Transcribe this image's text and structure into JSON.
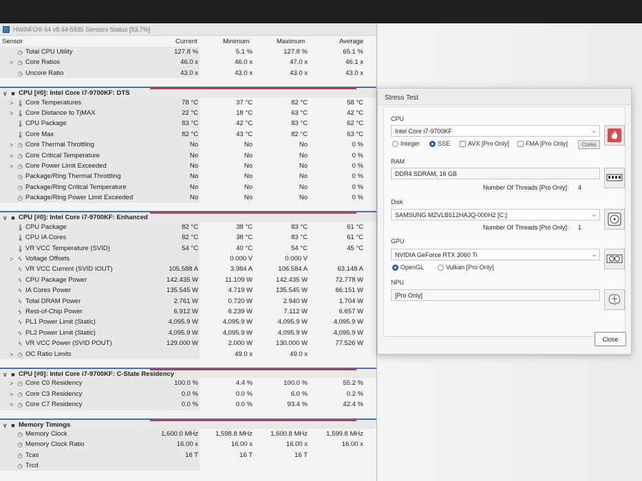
{
  "window_title": "HWiNFO® 64 v8.44-5935 Sensors Status [93.7%]",
  "columns": {
    "sensor": "Sensor",
    "current": "Current",
    "minimum": "Minimum",
    "maximum": "Maximum",
    "average": "Average"
  },
  "top_rows": [
    {
      "name": "Total CPU Utility",
      "icon": "clock-icon",
      "current": "127.8 %",
      "min": "5.1 %",
      "max": "127.8 %",
      "avg": "65.1 %"
    },
    {
      "name": "Core Ratios",
      "icon": "clock-icon",
      "expand": ">",
      "current": "46.0 x",
      "min": "46.0 x",
      "max": "47.0 x",
      "avg": "46.1 x"
    },
    {
      "name": "Uncore Ratio",
      "icon": "clock-icon",
      "current": "43.0 x",
      "min": "43.0 x",
      "max": "43.0 x",
      "avg": "43.0 x"
    }
  ],
  "sections": [
    {
      "title": "CPU [#0]: Intel Core i7-9700KF: DTS",
      "rows": [
        {
          "name": "Core Temperatures",
          "icon": "thermometer-icon",
          "expand": ">",
          "current": "78 °C",
          "min": "37 °C",
          "max": "82 °C",
          "avg": "58 °C"
        },
        {
          "name": "Core Distance to TjMAX",
          "icon": "thermometer-icon",
          "expand": ">",
          "current": "22 °C",
          "min": "18 °C",
          "max": "63 °C",
          "avg": "42 °C"
        },
        {
          "name": "CPU Package",
          "icon": "thermometer-icon",
          "current": "83 °C",
          "min": "42 °C",
          "max": "83 °C",
          "avg": "62 °C"
        },
        {
          "name": "Core Max",
          "icon": "thermometer-icon",
          "current": "82 °C",
          "min": "43 °C",
          "max": "82 °C",
          "avg": "63 °C"
        },
        {
          "name": "Core Thermal Throttling",
          "icon": "clock-icon",
          "expand": ">",
          "current": "No",
          "min": "No",
          "max": "No",
          "avg": "0 %"
        },
        {
          "name": "Core Critical Temperature",
          "icon": "clock-icon",
          "expand": ">",
          "current": "No",
          "min": "No",
          "max": "No",
          "avg": "0 %"
        },
        {
          "name": "Core Power Limit Exceeded",
          "icon": "clock-icon",
          "expand": ">",
          "current": "No",
          "min": "No",
          "max": "No",
          "avg": "0 %"
        },
        {
          "name": "Package/Ring Thermal Throttling",
          "icon": "clock-icon",
          "current": "No",
          "min": "No",
          "max": "No",
          "avg": "0 %"
        },
        {
          "name": "Package/Ring Critical Temperature",
          "icon": "clock-icon",
          "current": "No",
          "min": "No",
          "max": "No",
          "avg": "0 %"
        },
        {
          "name": "Package/Ring Power Limit Exceeded",
          "icon": "clock-icon",
          "current": "No",
          "min": "No",
          "max": "No",
          "avg": "0 %"
        }
      ]
    },
    {
      "title": "CPU [#0]: Intel Core i7-9700KF: Enhanced",
      "rows": [
        {
          "name": "CPU Package",
          "icon": "thermometer-icon",
          "current": "82 °C",
          "min": "38 °C",
          "max": "83 °C",
          "avg": "61 °C"
        },
        {
          "name": "CPU IA Cores",
          "icon": "thermometer-icon",
          "current": "82 °C",
          "min": "38 °C",
          "max": "83 °C",
          "avg": "61 °C"
        },
        {
          "name": "VR VCC Temperature (SVID)",
          "icon": "thermometer-icon",
          "current": "54 °C",
          "min": "40 °C",
          "max": "54 °C",
          "avg": "45 °C"
        },
        {
          "name": "Voltage Offsets",
          "icon": "lightning-icon",
          "expand": ">",
          "current": "",
          "min": "0.000 V",
          "max": "0.000 V",
          "avg": ""
        },
        {
          "name": "VR VCC Current (SVID IOUT)",
          "icon": "lightning-icon",
          "current": "105.588 A",
          "min": "3.984 A",
          "max": "106.584 A",
          "avg": "63.148 A"
        },
        {
          "name": "CPU Package Power",
          "icon": "lightning-icon",
          "current": "142.435 W",
          "min": "11.109 W",
          "max": "142.435 W",
          "avg": "72.778 W"
        },
        {
          "name": "IA Cores Power",
          "icon": "lightning-icon",
          "current": "135.545 W",
          "min": "4.719 W",
          "max": "135.545 W",
          "avg": "66.151 W"
        },
        {
          "name": "Total DRAM Power",
          "icon": "lightning-icon",
          "current": "2.761 W",
          "min": "0.720 W",
          "max": "2.940 W",
          "avg": "1.704 W"
        },
        {
          "name": "Rest-of-Chip Power",
          "icon": "lightning-icon",
          "current": "6.912 W",
          "min": "6.239 W",
          "max": "7.112 W",
          "avg": "6.657 W"
        },
        {
          "name": "PL1 Power Limit (Static)",
          "icon": "lightning-icon",
          "current": "4,095.9 W",
          "min": "4,095.9 W",
          "max": "4,095.9 W",
          "avg": "4,095.9 W"
        },
        {
          "name": "PL2 Power Limit (Static)",
          "icon": "lightning-icon",
          "current": "4,095.9 W",
          "min": "4,095.9 W",
          "max": "4,095.9 W",
          "avg": "4,095.9 W"
        },
        {
          "name": "VR VCC Power (SVID POUT)",
          "icon": "lightning-icon",
          "current": "129.000 W",
          "min": "2.000 W",
          "max": "130.000 W",
          "avg": "77.526 W"
        },
        {
          "name": "OC Ratio Limits",
          "icon": "clock-icon",
          "expand": ">",
          "current": "",
          "min": "49.0 x",
          "max": "49.0 x",
          "avg": ""
        }
      ]
    },
    {
      "title": "CPU [#0]: Intel Core i7-9700KF: C-State Residency",
      "rows": [
        {
          "name": "Core C0 Residency",
          "icon": "clock-icon",
          "expand": ">",
          "current": "100.0 %",
          "min": "4.4 %",
          "max": "100.0 %",
          "avg": "55.2 %"
        },
        {
          "name": "Core C3 Residency",
          "icon": "clock-icon",
          "expand": ">",
          "current": "0.0 %",
          "min": "0.0 %",
          "max": "6.0 %",
          "avg": "0.2 %"
        },
        {
          "name": "Core C7 Residency",
          "icon": "clock-icon",
          "expand": ">",
          "current": "0.0 %",
          "min": "0.0 %",
          "max": "93.4 %",
          "avg": "42.4 %"
        }
      ]
    },
    {
      "title": "Memory Timings",
      "rows": [
        {
          "name": "Memory Clock",
          "icon": "clock-icon",
          "current": "1,600.0 MHz",
          "min": "1,598.8 MHz",
          "max": "1,600.8 MHz",
          "avg": "1,599.8 MHz"
        },
        {
          "name": "Memory Clock Ratio",
          "icon": "clock-icon",
          "current": "16.00 x",
          "min": "16.00 x",
          "max": "16.00 x",
          "avg": "16.00 x"
        },
        {
          "name": "Tcas",
          "icon": "clock-icon",
          "current": "16 T",
          "min": "16 T",
          "max": "16 T",
          "avg": ""
        },
        {
          "name": "Trcd",
          "icon": "clock-icon",
          "current": "",
          "min": "",
          "max": "",
          "avg": ""
        }
      ]
    }
  ],
  "stress": {
    "title": "Stress Test",
    "cpu_label": "CPU",
    "cpu_value": "Intel Core i7-9700KF",
    "cpu_options": [
      "Integer",
      "SSE",
      "AVX [Pro Only]",
      "FMA [Pro Only]"
    ],
    "cores_label": "Cores",
    "ram_label": "RAM",
    "ram_value": "DDR4 SDRAM, 16 GB",
    "threads_label": "Number Of Threads [Pro Only]:",
    "ram_threads": "4",
    "disk_label": "Disk",
    "disk_value": "SAMSUNG MZVLB512HAJQ-000H2 [C:]",
    "disk_threads": "1",
    "gpu_label": "GPU",
    "gpu_value": "NVIDIA GeForce RTX 3060 Ti",
    "gpu_options": [
      "OpenGL",
      "Vulkan [Pro Only]"
    ],
    "npu_label": "NPU",
    "npu_value": "[Pro Only]",
    "close_label": "Close"
  }
}
